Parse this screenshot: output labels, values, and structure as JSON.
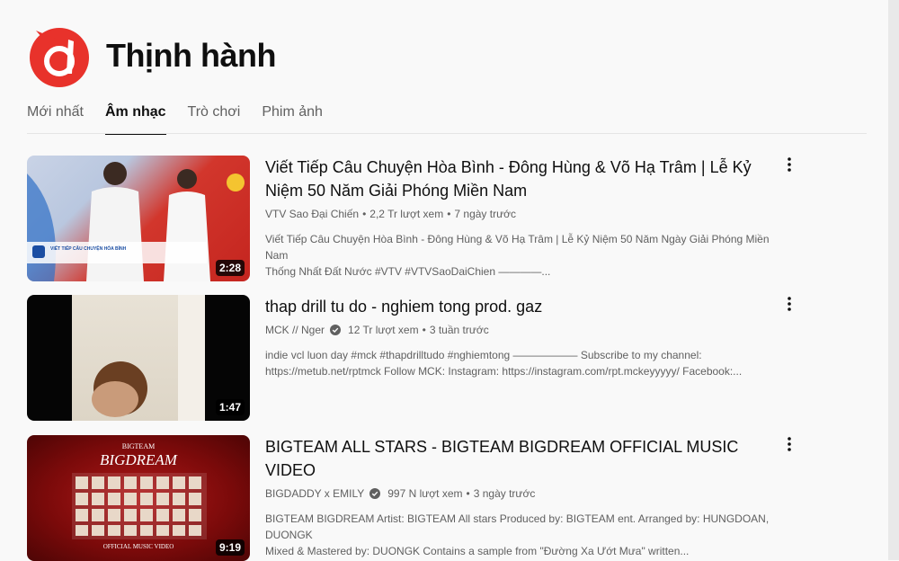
{
  "header": {
    "title": "Thịnh hành"
  },
  "tabs": [
    {
      "label": "Mới nhất",
      "active": false
    },
    {
      "label": "Âm nhạc",
      "active": true
    },
    {
      "label": "Trò chơi",
      "active": false
    },
    {
      "label": "Phim ảnh",
      "active": false
    }
  ],
  "videos": [
    {
      "title_line1": "Viết Tiếp Câu Chuyện Hòa Bình - Đông Hùng & Võ Hạ Trâm | Lễ Kỷ",
      "title_line2": "Niệm 50 Năm Giải Phóng Miền Nam",
      "channel": "VTV Sao Đại Chiến",
      "views": "2,2 Tr lượt xem",
      "age": "7 ngày trước",
      "desc_line1": "Viết Tiếp Câu Chuyện Hòa Bình - Đông Hùng & Võ Hạ Trâm | Lễ Kỷ Niệm 50 Năm Ngày Giải Phóng Miền Nam",
      "desc_line2": "Thống Nhất Đất Nước #VTV #VTVSaoDaiChien ————...",
      "duration": "2:28",
      "thumb_caption": "VIẾT TIẾP CÂU CHUYỆN HÒA BÌNH"
    },
    {
      "title_line1": "thap drill tu do - nghiem tong prod. gaz",
      "channel": "MCK // Nger",
      "verified": true,
      "views": "12 Tr lượt xem",
      "age": "3 tuần trước",
      "desc_line1": "indie vcl luon day #mck #thapdrilltudo #nghiemtong —————— Subscribe to my channel:",
      "desc_line2": "https://metub.net/rptmck Follow MCK: Instagram: https://instagram.com/rpt.mckeyyyyy/ Facebook:...",
      "duration": "1:47"
    },
    {
      "title_line1": "BIGTEAM ALL STARS - BIGTEAM BIGDREAM OFFICIAL MUSIC VIDEO",
      "channel": "BIGDADDY x EMILY",
      "verified": true,
      "views": "997 N lượt xem",
      "age": "3 ngày trước",
      "desc_line1": "BIGTEAM BIGDREAM Artist: BIGTEAM All stars Produced by: BIGTEAM ent. Arranged by: HUNGDOAN, DUONGK",
      "desc_line2": "Mixed & Mastered by: DUONGK Contains a sample from \"Đường Xa Ướt Mưa\" written...",
      "duration": "9:19",
      "thumb_text_top": "BIGTEAM",
      "thumb_text_main": "BIGDREAM",
      "thumb_text_bottom": "OFFICIAL MUSIC VIDEO"
    }
  ],
  "icons": {
    "logo": "trending-music-logo-icon",
    "more": "more-vert-icon",
    "verified": "verified-icon"
  },
  "colors": {
    "brand_red": "#e8322b",
    "text_primary": "#0f0f0f",
    "text_secondary": "#606060"
  }
}
